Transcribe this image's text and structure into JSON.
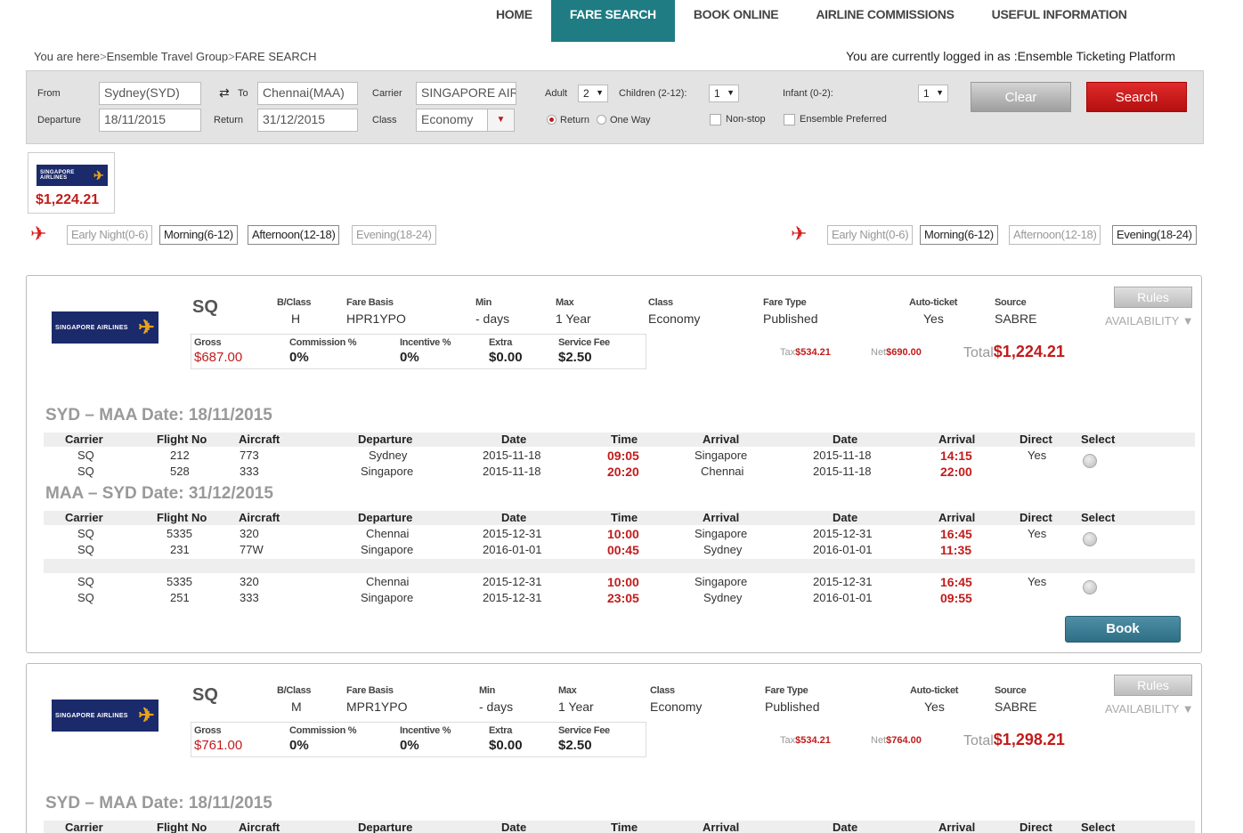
{
  "nav": {
    "tabs": [
      {
        "label": "HOME"
      },
      {
        "label": "FARE SEARCH"
      },
      {
        "label": "BOOK ONLINE"
      },
      {
        "label": "AIRLINE COMMISSIONS"
      },
      {
        "label": "USEFUL INFORMATION"
      }
    ],
    "active": "FARE SEARCH"
  },
  "breadcrumb": {
    "prefix": "You are here",
    "items": [
      "Ensemble Travel Group",
      "FARE SEARCH"
    ]
  },
  "user": {
    "logged_in_text": "You are currently logged in as :Ensemble Ticketing Platform"
  },
  "search": {
    "from_label": "From",
    "from_value": "Sydney(SYD)",
    "to_label": "To",
    "to_value": "Chennai(MAA)",
    "carrier_label": "Carrier",
    "carrier_value": "SINGAPORE AIRI",
    "departure_label": "Departure",
    "departure_value": "18/11/2015",
    "return_label": "Return",
    "return_value": "31/12/2015",
    "class_label": "Class",
    "class_value": "Economy",
    "adult_label": "Adult",
    "adult_value": "2",
    "children_label": "Children (2-12):",
    "children_value": "1",
    "infant_label": "Infant (0-2):",
    "infant_value": "1",
    "radio_return": "Return",
    "radio_oneway": "One Way",
    "trip_type": "Return",
    "nonstop_label": "Non-stop",
    "preferred_label": "Ensemble Preferred",
    "clear_label": "Clear",
    "search_label": "Search"
  },
  "airline_tile": {
    "logo_text": "SINGAPORE AIRLINES",
    "price": "$1,224.21"
  },
  "filters": {
    "outbound": [
      {
        "label": "Early Night(0-6)",
        "active": false
      },
      {
        "label": "Morning(6-12)",
        "active": true
      },
      {
        "label": "Afternoon(12-18)",
        "active": true
      },
      {
        "label": "Evening(18-24)",
        "active": false
      }
    ],
    "inbound": [
      {
        "label": "Early Night(0-6)",
        "active": false
      },
      {
        "label": "Morning(6-12)",
        "active": true
      },
      {
        "label": "Afternoon(12-18)",
        "active": false
      },
      {
        "label": "Evening(18-24)",
        "active": true
      }
    ]
  },
  "field_headers": {
    "bclass": "B/Class",
    "fare_basis": "Fare Basis",
    "min": "Min",
    "max": "Max",
    "class": "Class",
    "fare_type": "Fare Type",
    "auto_ticket": "Auto-ticket",
    "source": "Source",
    "gross": "Gross",
    "commission": "Commission %",
    "incentive": "Incentive %",
    "extra": "Extra",
    "service_fee": "Service Fee",
    "tax": "Tax",
    "net": "Net",
    "total": "Total",
    "rules": "Rules",
    "availability": "AVAILABILITY ▼",
    "book": "Book"
  },
  "col_headers": [
    "Carrier",
    "Flight No",
    "Aircraft",
    "Departure",
    "Date",
    "Time",
    "Arrival",
    "Date",
    "Arrival",
    "Direct",
    "Select"
  ],
  "results": [
    {
      "logo_text": "SINGAPORE AIRLINES",
      "carrier": "SQ",
      "bclass": "H",
      "fare_basis": "HPR1YPO",
      "min": "- days",
      "max": "1 Year",
      "class": "Economy",
      "fare_type": "Published",
      "auto_ticket": "Yes",
      "source": "SABRE",
      "gross": "$687.00",
      "commission": "0%",
      "incentive": "0%",
      "extra": "$0.00",
      "service_fee": "$2.50",
      "tax": "$534.21",
      "net": "$690.00",
      "total": "$1,224.21",
      "outbound": {
        "title": "SYD – MAA  Date: 18/11/2015",
        "options": [
          {
            "direct": "Yes",
            "flights": [
              {
                "carrier": "SQ",
                "flight": "212",
                "aircraft": "773",
                "dep": "Sydney",
                "dep_date": "2015-11-18",
                "dep_time": "09:05",
                "arr": "Singapore",
                "arr_date": "2015-11-18",
                "arr_time": "14:15"
              },
              {
                "carrier": "SQ",
                "flight": "528",
                "aircraft": "333",
                "dep": "Singapore",
                "dep_date": "2015-11-18",
                "dep_time": "20:20",
                "arr": "Chennai",
                "arr_date": "2015-11-18",
                "arr_time": "22:00"
              }
            ]
          }
        ]
      },
      "inbound": {
        "title": "MAA – SYD  Date: 31/12/2015",
        "options": [
          {
            "direct": "Yes",
            "flights": [
              {
                "carrier": "SQ",
                "flight": "5335",
                "aircraft": "320",
                "dep": "Chennai",
                "dep_date": "2015-12-31",
                "dep_time": "10:00",
                "arr": "Singapore",
                "arr_date": "2015-12-31",
                "arr_time": "16:45"
              },
              {
                "carrier": "SQ",
                "flight": "231",
                "aircraft": "77W",
                "dep": "Singapore",
                "dep_date": "2016-01-01",
                "dep_time": "00:45",
                "arr": "Sydney",
                "arr_date": "2016-01-01",
                "arr_time": "11:35"
              }
            ]
          },
          {
            "direct": "Yes",
            "flights": [
              {
                "carrier": "SQ",
                "flight": "5335",
                "aircraft": "320",
                "dep": "Chennai",
                "dep_date": "2015-12-31",
                "dep_time": "10:00",
                "arr": "Singapore",
                "arr_date": "2015-12-31",
                "arr_time": "16:45"
              },
              {
                "carrier": "SQ",
                "flight": "251",
                "aircraft": "333",
                "dep": "Singapore",
                "dep_date": "2015-12-31",
                "dep_time": "23:05",
                "arr": "Sydney",
                "arr_date": "2016-01-01",
                "arr_time": "09:55"
              }
            ]
          }
        ]
      }
    },
    {
      "logo_text": "SINGAPORE AIRLINES",
      "carrier": "SQ",
      "bclass": "M",
      "fare_basis": "MPR1YPO",
      "min": "- days",
      "max": "1 Year",
      "class": "Economy",
      "fare_type": "Published",
      "auto_ticket": "Yes",
      "source": "SABRE",
      "gross": "$761.00",
      "commission": "0%",
      "incentive": "0%",
      "extra": "$0.00",
      "service_fee": "$2.50",
      "tax": "$534.21",
      "net": "$764.00",
      "total": "$1,298.21",
      "outbound": {
        "title": "SYD – MAA  Date: 18/11/2015",
        "options": []
      }
    }
  ],
  "colors": {
    "nav_active": "#1f7c83",
    "price_red": "#c21b1b",
    "search_red": "#c8161a",
    "book_blue": "#3a7d94"
  }
}
